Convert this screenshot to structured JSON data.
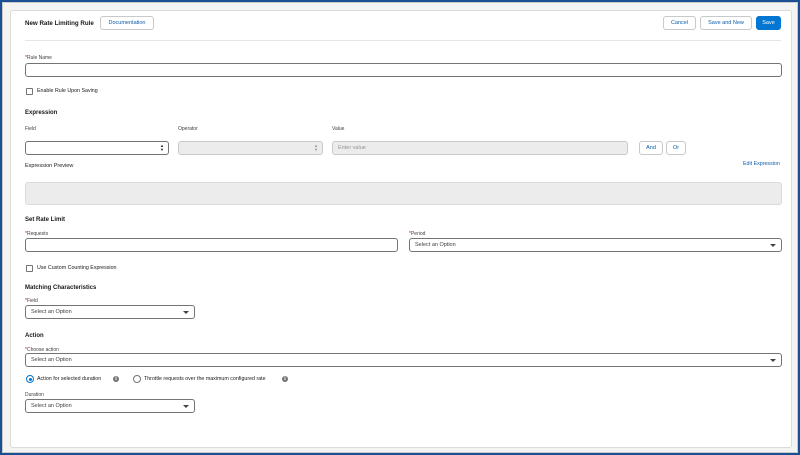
{
  "header": {
    "title": "New Rate Limiting Rule",
    "documentation_label": "Documentation",
    "cancel_label": "Cancel",
    "save_and_new_label": "Save and New",
    "save_label": "Save"
  },
  "rule_name": {
    "label": "Rule Name",
    "required_mark": "*",
    "value": ""
  },
  "enable_rule": {
    "label": "Enable Rule Upon Saving",
    "checked": false
  },
  "expression": {
    "heading": "Expression",
    "field_label": "Field",
    "operator_label": "Operator",
    "value_label": "Value",
    "value_placeholder": "Enter value",
    "and_label": "And",
    "or_label": "Or",
    "edit_link": "Edit Expression",
    "preview_label": "Expression Preview"
  },
  "rate_limit": {
    "heading": "Set Rate Limit",
    "requests_label": "Requests",
    "period_label": "Period",
    "period_value": "Select an Option",
    "required_mark": "*"
  },
  "custom_counting": {
    "label": "Use Custom Counting Expression",
    "checked": false
  },
  "matching": {
    "heading": "Matching Characteristics",
    "field_label": "Field",
    "field_value": "Select an Option",
    "required_mark": "*"
  },
  "action": {
    "heading": "Action",
    "choose_label": "Choose action",
    "choose_value": "Select an Option",
    "required_mark": "*",
    "radio_duration_label": "Action for selected duration",
    "radio_throttle_label": "Throttle requests over the maximum configured rate",
    "selected": "duration",
    "duration_label": "Duration",
    "duration_value": "Select an Option",
    "info_icon_glyph": "i"
  },
  "colors": {
    "brand": "#0176d3",
    "frame": "#1b4f93",
    "link": "#0b5cab",
    "required": "#ba0517"
  }
}
